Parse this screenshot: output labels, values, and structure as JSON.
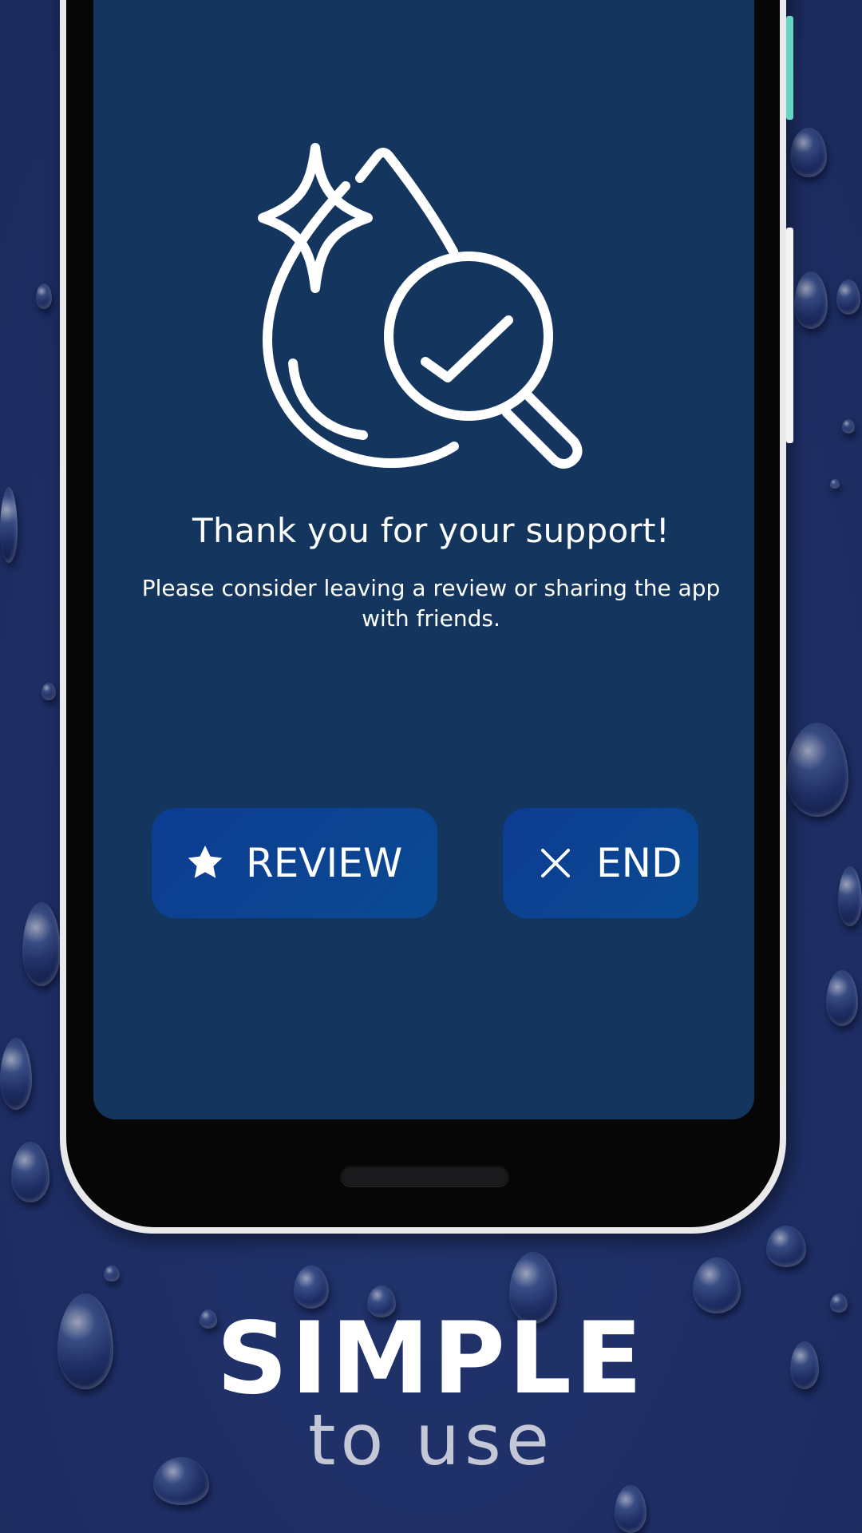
{
  "dialog": {
    "title": "Thank you for your support!",
    "message": "Please consider leaving a review or sharing the app with friends.",
    "hero_icon": "water-drop-search-check-icon"
  },
  "buttons": {
    "review": {
      "label": "REVIEW",
      "icon": "star-icon"
    },
    "end": {
      "label": "END",
      "icon": "close-icon"
    }
  },
  "promo": {
    "headline": "SIMPLE",
    "tagline": "to use"
  },
  "colors": {
    "background": "#1f2f66",
    "screen": "#14365e",
    "button": "#0d3c92",
    "accent_side_button": "#65d6c3"
  }
}
